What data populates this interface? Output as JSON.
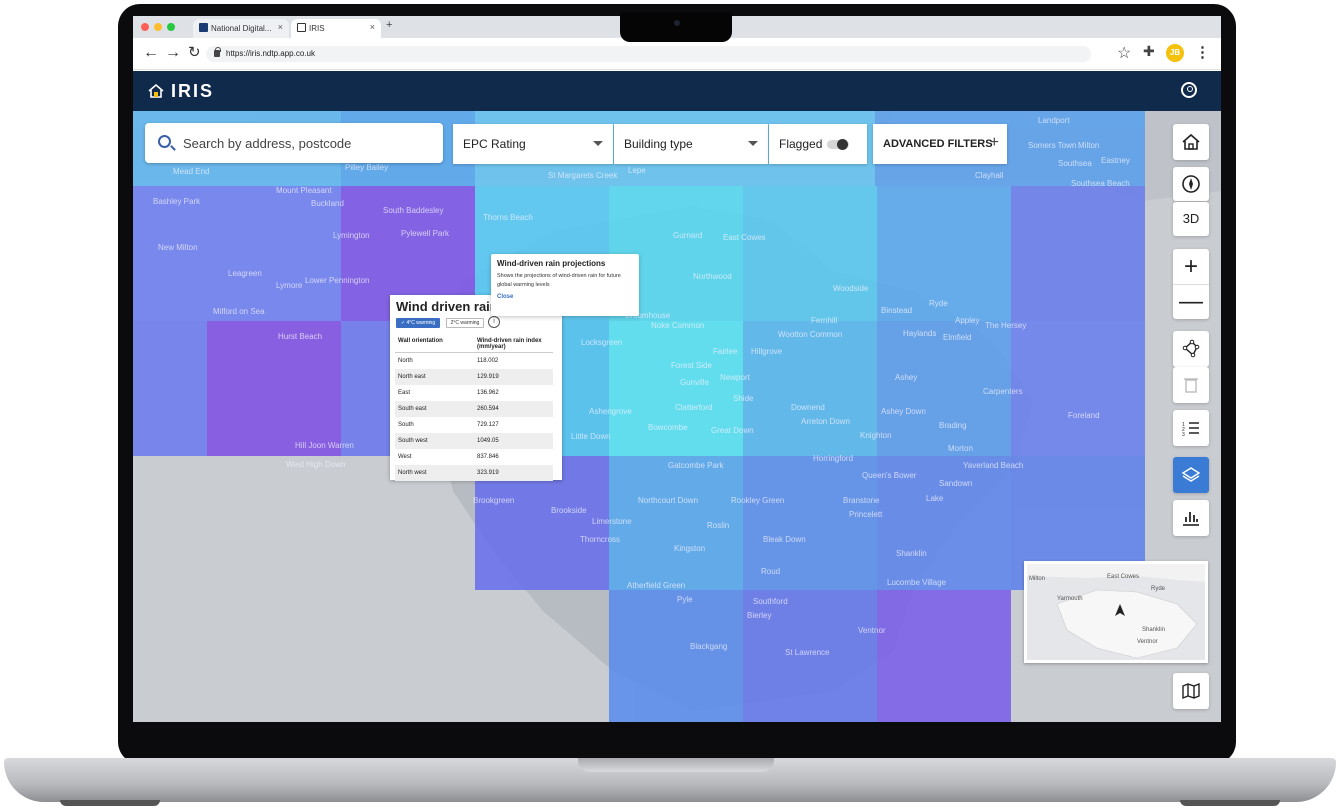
{
  "browser": {
    "tabs": [
      {
        "label": "National Digital...",
        "close": "×"
      },
      {
        "label": "IRIS",
        "close": "×"
      }
    ],
    "new_tab": "+",
    "url": "https://iris.ndtp.app.co.uk",
    "profile_initials": "JB"
  },
  "app": {
    "title": "IRIS"
  },
  "filters": {
    "search_placeholder": "Search by address, postcode",
    "epc_label": "EPC Rating",
    "building_label": "Building type",
    "flagged_label": "Flagged",
    "advanced_label": "ADVANCED FILTERS",
    "advanced_plus": "+"
  },
  "tools": {
    "three_d": "3D"
  },
  "tooltip": {
    "title": "Wind-driven rain projections",
    "body": "Shows the projections of wind-driven rain for future global warming levels",
    "close": "Close"
  },
  "panel": {
    "title": "Wind driven rain",
    "chip_4c": "✓ 4°C warming",
    "chip_2c": "2°C warming",
    "info": "i",
    "col_orientation": "Wall orientation",
    "col_index": "Wind-driven rain index (mm/year)",
    "rows": [
      {
        "orientation": "North",
        "value": "118.002"
      },
      {
        "orientation": "North east",
        "value": "129.919"
      },
      {
        "orientation": "East",
        "value": "136.962"
      },
      {
        "orientation": "South east",
        "value": "260.594"
      },
      {
        "orientation": "South",
        "value": "729.127"
      },
      {
        "orientation": "South west",
        "value": "1049.05"
      },
      {
        "orientation": "West",
        "value": "837.846"
      },
      {
        "orientation": "North west",
        "value": "323.919"
      }
    ]
  },
  "map_places": [
    "Landport",
    "Somers Town",
    "Milton",
    "Southsea",
    "Eastney",
    "Southsea Beach",
    "Clayhall",
    "Mead End",
    "Pilley Bailey",
    "St Margarets Creek",
    "Lepe",
    "Bashley Park",
    "Mount Pleasant",
    "Buckland",
    "South Baddesley",
    "Thorns Beach",
    "Lymington",
    "Pylewell Park",
    "New Milton",
    "Gurnard",
    "East Cowes",
    "Leagreen",
    "Lymore",
    "Lower Pennington",
    "Northwood",
    "Woodside",
    "Milford on Sea",
    "Hurst Beach",
    "Noke Common",
    "Fernhill",
    "Binstead",
    "Ryde",
    "Appley",
    "The Hersey",
    "Wootton Common",
    "Haylands",
    "Elmfield",
    "Fairlee",
    "Hillgrove",
    "Forest Side",
    "Gunville",
    "Newport",
    "Shide",
    "Ashey",
    "Carpenters",
    "Clatterford",
    "Downend",
    "Ashey Down",
    "Foreland",
    "Bowcombe",
    "Great Down",
    "Arreton Down",
    "Brading",
    "Knighton",
    "Hill Joon Warren",
    "Little Down",
    "West High Down",
    "Morton",
    "Horringford",
    "Gatcombe Park",
    "Queen's Bower",
    "Yaverland Beach",
    "Sandown",
    "Brookgreen",
    "Northcourt Down",
    "Rookley Green",
    "Branstone",
    "Lake",
    "Brookside",
    "Limerstone",
    "Princelett",
    "Roslin",
    "Thorncross",
    "Bleak Down",
    "Kingston",
    "Shanklin",
    "Roud",
    "Atherfield Green",
    "Lucombe Village",
    "Pyle",
    "Southford",
    "Bierley",
    "Ventnor",
    "Blackgang",
    "St Lawrence",
    "Ashengrove",
    "Locksgreen",
    "Broomhouse"
  ],
  "minimap_places": [
    "Milton",
    "East Cowes",
    "Ryde",
    "Yarmouth",
    "Shanklin",
    "Ventnor"
  ]
}
